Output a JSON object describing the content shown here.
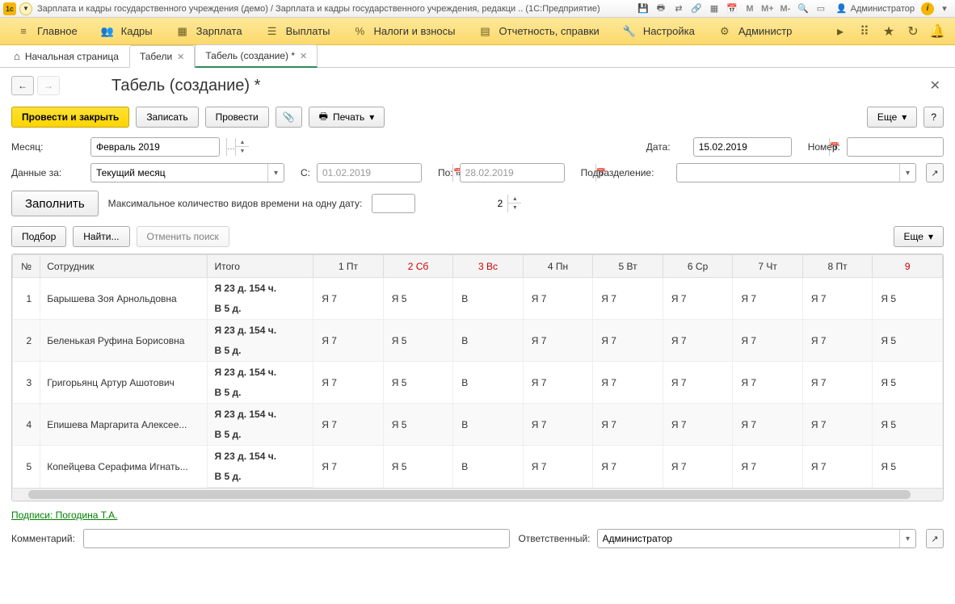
{
  "titlebar": {
    "app_title": "Зарплата и кадры государственного учреждения (демо) / Зарплата и кадры государственного учреждения, редакци .. (1С:Предприятие)",
    "user_label": "Администратор"
  },
  "mainmenu": {
    "items": [
      "Главное",
      "Кадры",
      "Зарплата",
      "Выплаты",
      "Налоги и взносы",
      "Отчетность, справки",
      "Настройка",
      "Администр"
    ]
  },
  "tabs": {
    "home": "Начальная страница",
    "tab1": "Табели",
    "tab2": "Табель (создание) *"
  },
  "page": {
    "title": "Табель (создание) *"
  },
  "toolbar": {
    "submit_close": "Провести и закрыть",
    "save": "Записать",
    "submit": "Провести",
    "print": "Печать",
    "more": "Еще",
    "help": "?"
  },
  "form": {
    "month_label": "Месяц:",
    "month_value": "Февраль 2019",
    "date_label": "Дата:",
    "date_value": "15.02.2019",
    "number_label": "Номер:",
    "number_value": "",
    "data_for_label": "Данные за:",
    "data_for_value": "Текущий месяц",
    "from_label": "С:",
    "from_value": "01.02.2019",
    "to_label": "По:",
    "to_value": "28.02.2019",
    "dept_label": "Подразделение:",
    "dept_value": ""
  },
  "fill": {
    "button": "Заполнить",
    "max_label": "Максимальное количество видов времени на одну дату:",
    "max_value": "2"
  },
  "subtoolbar": {
    "pick": "Подбор",
    "find": "Найти...",
    "cancel_find": "Отменить поиск",
    "more": "Еще"
  },
  "grid": {
    "headers": {
      "num": "№",
      "emp": "Сотрудник",
      "total": "Итого",
      "days": [
        {
          "label": "1 Пт",
          "weekend": false
        },
        {
          "label": "2 Сб",
          "weekend": true
        },
        {
          "label": "3 Вс",
          "weekend": true
        },
        {
          "label": "4 Пн",
          "weekend": false
        },
        {
          "label": "5 Вт",
          "weekend": false
        },
        {
          "label": "6 Ср",
          "weekend": false
        },
        {
          "label": "7 Чт",
          "weekend": false
        },
        {
          "label": "8 Пт",
          "weekend": false
        },
        {
          "label": "9",
          "weekend": true
        }
      ]
    },
    "rows": [
      {
        "num": "1",
        "emp": "Барышева Зоя Арнольдовна",
        "total1": "Я 23 д. 154 ч.",
        "total2": "В 5 д.",
        "cells": [
          "Я 7",
          "Я 5",
          "В",
          "Я 7",
          "Я 7",
          "Я 7",
          "Я 7",
          "Я 7",
          "Я 5"
        ]
      },
      {
        "num": "2",
        "emp": "Беленькая Руфина Борисовна",
        "total1": "Я 23 д. 154 ч.",
        "total2": "В 5 д.",
        "cells": [
          "Я 7",
          "Я 5",
          "В",
          "Я 7",
          "Я 7",
          "Я 7",
          "Я 7",
          "Я 7",
          "Я 5"
        ]
      },
      {
        "num": "3",
        "emp": "Григорьянц Артур Ашотович",
        "total1": "Я 23 д. 154 ч.",
        "total2": "В 5 д.",
        "cells": [
          "Я 7",
          "Я 5",
          "В",
          "Я 7",
          "Я 7",
          "Я 7",
          "Я 7",
          "Я 7",
          "Я 5"
        ]
      },
      {
        "num": "4",
        "emp": "Епишева Маргарита Алексее...",
        "total1": "Я 23 д. 154 ч.",
        "total2": "В 5 д.",
        "cells": [
          "Я 7",
          "Я 5",
          "В",
          "Я 7",
          "Я 7",
          "Я 7",
          "Я 7",
          "Я 7",
          "Я 5"
        ]
      },
      {
        "num": "5",
        "emp": "Копейцева Серафима Игнать...",
        "total1": "Я 23 д. 154 ч.",
        "total2": "В 5 д.",
        "cells": [
          "Я 7",
          "Я 5",
          "В",
          "Я 7",
          "Я 7",
          "Я 7",
          "Я 7",
          "Я 7",
          "Я 5"
        ]
      }
    ]
  },
  "signatures_link": "Подписи: Погодина Т.А.",
  "footer": {
    "comment_label": "Комментарий:",
    "comment_value": "",
    "responsible_label": "Ответственный:",
    "responsible_value": "Администратор"
  }
}
